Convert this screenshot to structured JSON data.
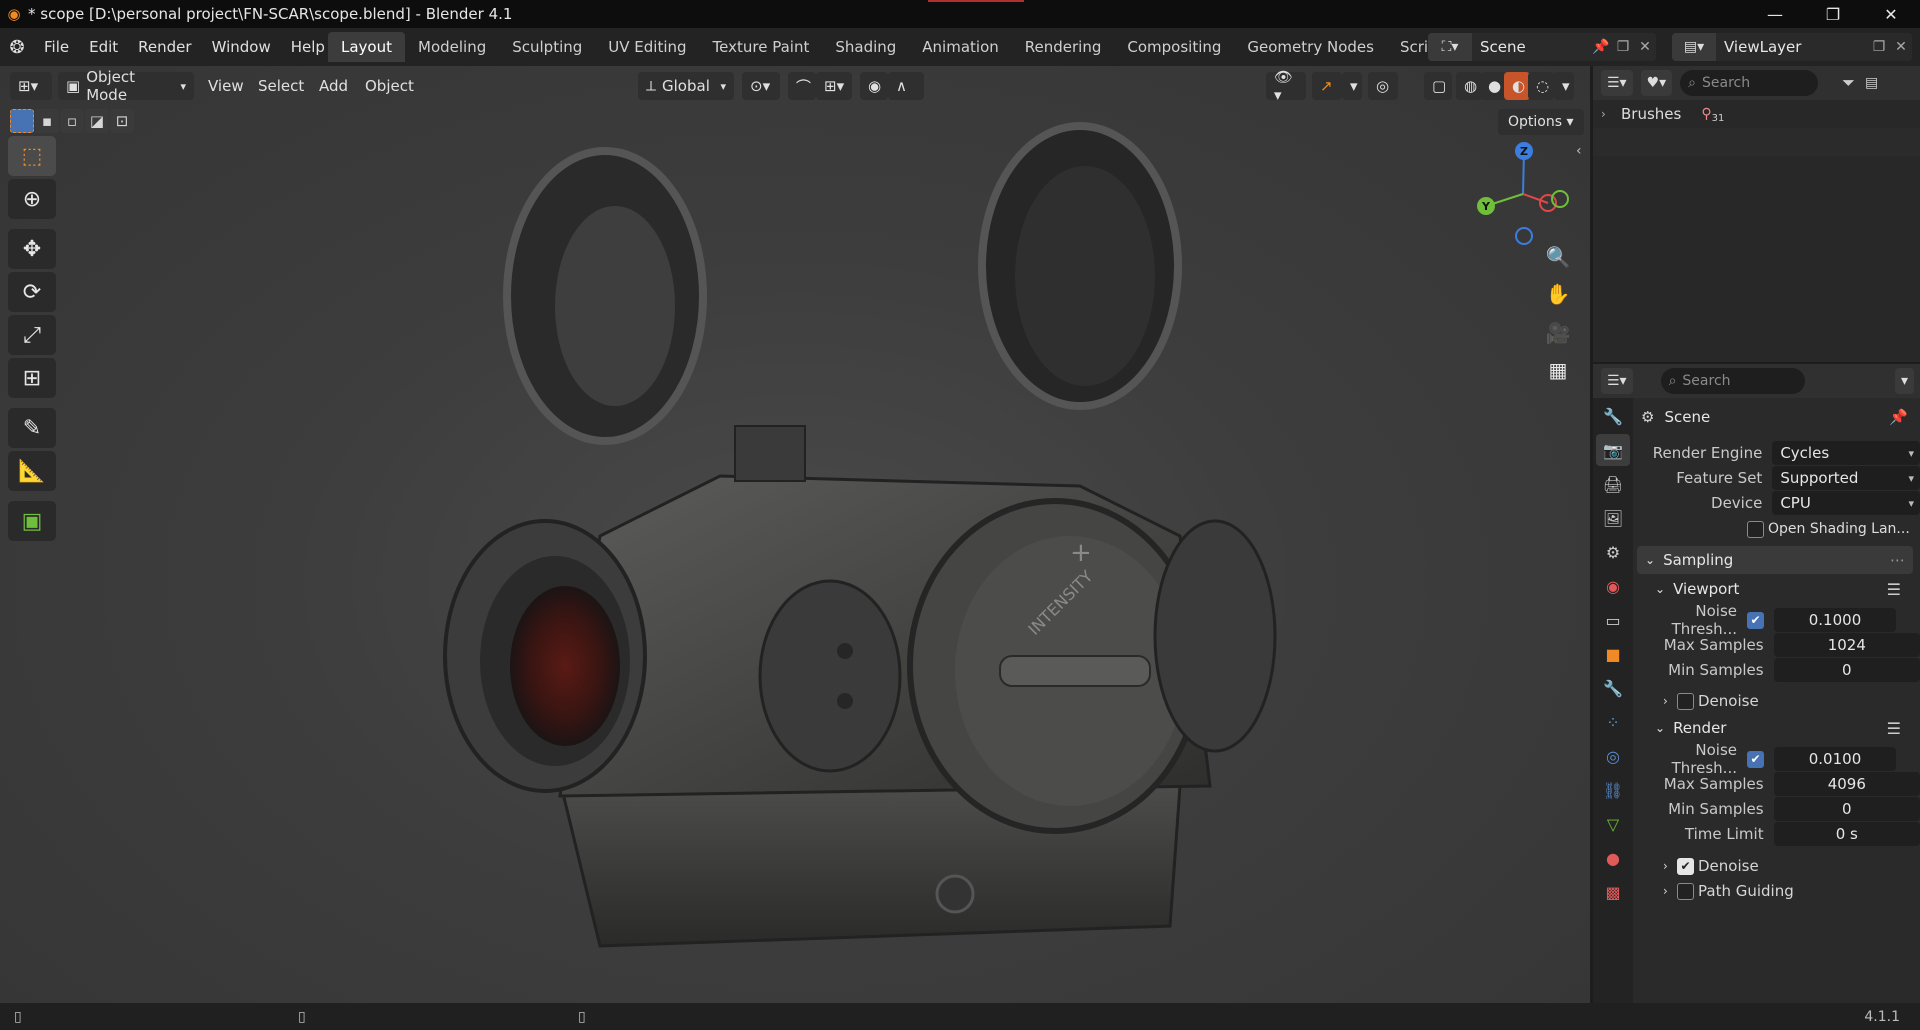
{
  "window": {
    "title": "* scope [D:\\personal project\\FN-SCAR\\scope.blend] - Blender 4.1",
    "minimize": "—",
    "maximize": "❐",
    "close": "✕"
  },
  "menus": [
    "File",
    "Edit",
    "Render",
    "Window",
    "Help"
  ],
  "workspaces": [
    "Layout",
    "Modeling",
    "Sculpting",
    "UV Editing",
    "Texture Paint",
    "Shading",
    "Animation",
    "Rendering",
    "Compositing",
    "Geometry Nodes",
    "Scripting"
  ],
  "workspace_add": "+",
  "scene": {
    "name": "Scene",
    "view_layer": "ViewLayer"
  },
  "viewport": {
    "mode": "Object Mode",
    "menus": [
      "View",
      "Select",
      "Add",
      "Object"
    ],
    "orientation": "Global",
    "options": "Options",
    "gizmo_axes": {
      "z": "Z",
      "y": "Y",
      "x": "X"
    }
  },
  "outliner": {
    "search_placeholder": "Search",
    "items": [
      {
        "label": "Brushes",
        "count": "31"
      }
    ]
  },
  "properties": {
    "search_placeholder": "Search",
    "context": "Scene",
    "render_engine_label": "Render Engine",
    "render_engine": "Cycles",
    "feature_set_label": "Feature Set",
    "feature_set": "Supported",
    "device_label": "Device",
    "device": "CPU",
    "osl_label": "Open Shading Lan...",
    "sampling": {
      "title": "Sampling",
      "viewport": {
        "title": "Viewport",
        "noise_label": "Noise Thresh...",
        "noise_value": "0.1000",
        "max_label": "Max Samples",
        "max_value": "1024",
        "min_label": "Min Samples",
        "min_value": "0",
        "denoise_label": "Denoise"
      },
      "render": {
        "title": "Render",
        "noise_label": "Noise Thresh...",
        "noise_value": "0.0100",
        "max_label": "Max Samples",
        "max_value": "4096",
        "min_label": "Min Samples",
        "min_value": "0",
        "time_label": "Time Limit",
        "time_value": "0 s",
        "denoise_label": "Denoise",
        "path_guiding_label": "Path Guiding"
      }
    }
  },
  "status": {
    "version": "4.1.1"
  },
  "colors": {
    "accent_orange": "#f08a24",
    "selection_blue": "#4772b3",
    "axis_x": "#e04848",
    "axis_y": "#6fbf3a",
    "axis_z": "#3c7de0"
  }
}
